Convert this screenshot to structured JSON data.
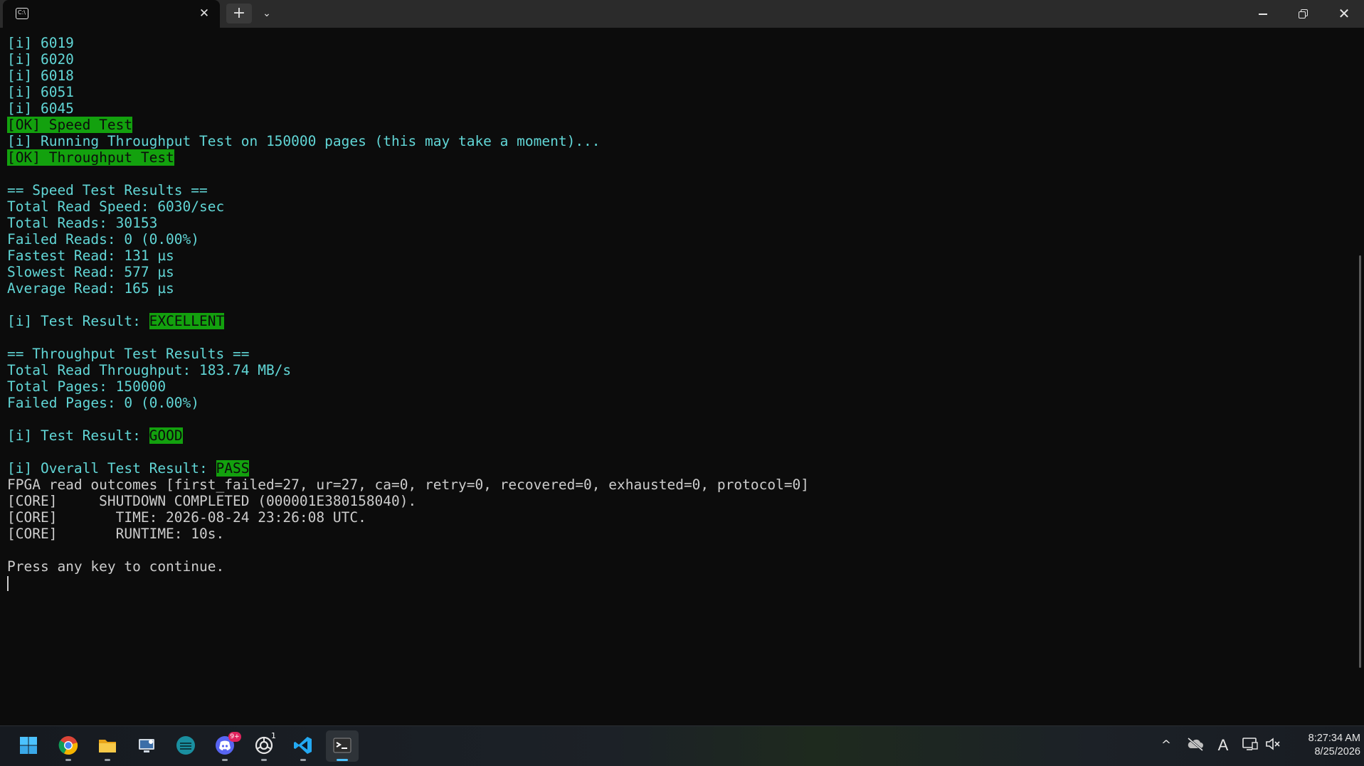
{
  "titlebar": {
    "tab_icon_text": "C:\\",
    "tab_close": "✕",
    "new_tab": "+",
    "dropdown": "⌄",
    "minimize": "minimize",
    "maximize": "restore",
    "close": "✕"
  },
  "terminal": {
    "lines": [
      [
        {
          "t": "[i] 6019",
          "c": "cyan"
        }
      ],
      [
        {
          "t": "[i] 6020",
          "c": "cyan"
        }
      ],
      [
        {
          "t": "[i] 6018",
          "c": "cyan"
        }
      ],
      [
        {
          "t": "[i] 6051",
          "c": "cyan"
        }
      ],
      [
        {
          "t": "[i] 6045",
          "c": "cyan"
        }
      ],
      [
        {
          "t": "[OK] Speed Test",
          "c": "hl"
        }
      ],
      [
        {
          "t": "[i] Running Throughput Test on 150000 pages (this may take a moment)...",
          "c": "cyan"
        }
      ],
      [
        {
          "t": "[OK] Throughput Test",
          "c": "hl"
        }
      ],
      [
        {
          "t": "",
          "c": "white"
        }
      ],
      [
        {
          "t": "== Speed Test Results ==",
          "c": "cyan"
        }
      ],
      [
        {
          "t": "Total Read Speed: 6030/sec",
          "c": "cyan"
        }
      ],
      [
        {
          "t": "Total Reads: 30153",
          "c": "cyan"
        }
      ],
      [
        {
          "t": "Failed Reads: 0 (0.00%)",
          "c": "cyan"
        }
      ],
      [
        {
          "t": "Fastest Read: 131 µs",
          "c": "cyan"
        }
      ],
      [
        {
          "t": "Slowest Read: 577 µs",
          "c": "cyan"
        }
      ],
      [
        {
          "t": "Average Read: 165 µs",
          "c": "cyan"
        }
      ],
      [
        {
          "t": "",
          "c": "white"
        }
      ],
      [
        {
          "t": "[i] Test Result: ",
          "c": "cyan"
        },
        {
          "t": "EXCELLENT",
          "c": "hl"
        }
      ],
      [
        {
          "t": "",
          "c": "white"
        }
      ],
      [
        {
          "t": "== Throughput Test Results ==",
          "c": "cyan"
        }
      ],
      [
        {
          "t": "Total Read Throughput: 183.74 MB/s",
          "c": "cyan"
        }
      ],
      [
        {
          "t": "Total Pages: 150000",
          "c": "cyan"
        }
      ],
      [
        {
          "t": "Failed Pages: 0 (0.00%)",
          "c": "cyan"
        }
      ],
      [
        {
          "t": "",
          "c": "white"
        }
      ],
      [
        {
          "t": "[i] Test Result: ",
          "c": "cyan"
        },
        {
          "t": "GOOD",
          "c": "hl-dark"
        }
      ],
      [
        {
          "t": "",
          "c": "white"
        }
      ],
      [
        {
          "t": "[i] Overall Test Result: ",
          "c": "cyan"
        },
        {
          "t": "PASS",
          "c": "hl"
        }
      ],
      [
        {
          "t": "FPGA read outcomes [first_failed=27, ur=27, ca=0, retry=0, recovered=0, exhausted=0, protocol=0]",
          "c": "white"
        }
      ],
      [
        {
          "t": "[CORE]     SHUTDOWN COMPLETED (000001E380158040).",
          "c": "white"
        }
      ],
      [
        {
          "t": "[CORE]       TIME: 2026-08-24 23:26:08 UTC.",
          "c": "white"
        }
      ],
      [
        {
          "t": "[CORE]       RUNTIME: 10s.",
          "c": "white"
        }
      ],
      [
        {
          "t": "",
          "c": "white"
        }
      ],
      [
        {
          "t": "Press any key to continue.",
          "c": "white"
        }
      ]
    ]
  },
  "colors": {
    "terminal_bg": "#0c0c0c",
    "cyan": "#61d6d6",
    "white": "#cccccc",
    "highlight_green": "#13a10e",
    "titlebar_bg": "#2b2b2b"
  },
  "taskbar": {
    "apps": [
      {
        "name": "start-menu-button",
        "icon": "windows-logo-icon"
      },
      {
        "name": "chrome-app",
        "icon": "chrome-icon"
      },
      {
        "name": "file-explorer-app",
        "icon": "folder-icon"
      },
      {
        "name": "remote-desktop-app",
        "icon": "remote-desktop-icon"
      },
      {
        "name": "app-teal",
        "icon": "teal-circle-icon"
      },
      {
        "name": "discord-app",
        "icon": "discord-icon",
        "badge": "9+"
      },
      {
        "name": "chatgpt-app",
        "icon": "openai-icon",
        "badge": "1"
      },
      {
        "name": "vscode-app",
        "icon": "vscode-icon"
      },
      {
        "name": "terminal-app",
        "icon": "terminal-icon",
        "active": true
      }
    ],
    "tray": {
      "overflow": "^",
      "language": "A"
    },
    "clock": {
      "time": "8:27:34 AM",
      "date": "8/25/2026"
    }
  }
}
